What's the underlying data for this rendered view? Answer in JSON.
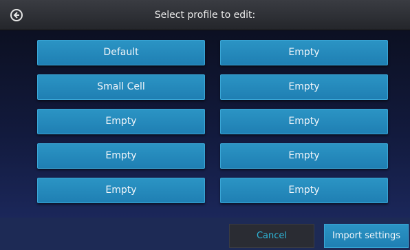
{
  "header": {
    "title": "Select profile to edit:",
    "back_icon": "back-arrow-circle-icon"
  },
  "profiles": {
    "left": [
      "Default",
      "Small Cell",
      "Empty",
      "Empty",
      "Empty"
    ],
    "right": [
      "Empty",
      "Empty",
      "Empty",
      "Empty",
      "Empty"
    ]
  },
  "footer": {
    "cancel_label": "Cancel",
    "import_label": "Import settings"
  },
  "colors": {
    "button_blue": "#2388bb",
    "cancel_text": "#2eb6d8",
    "header_bg": "#2e3035"
  }
}
